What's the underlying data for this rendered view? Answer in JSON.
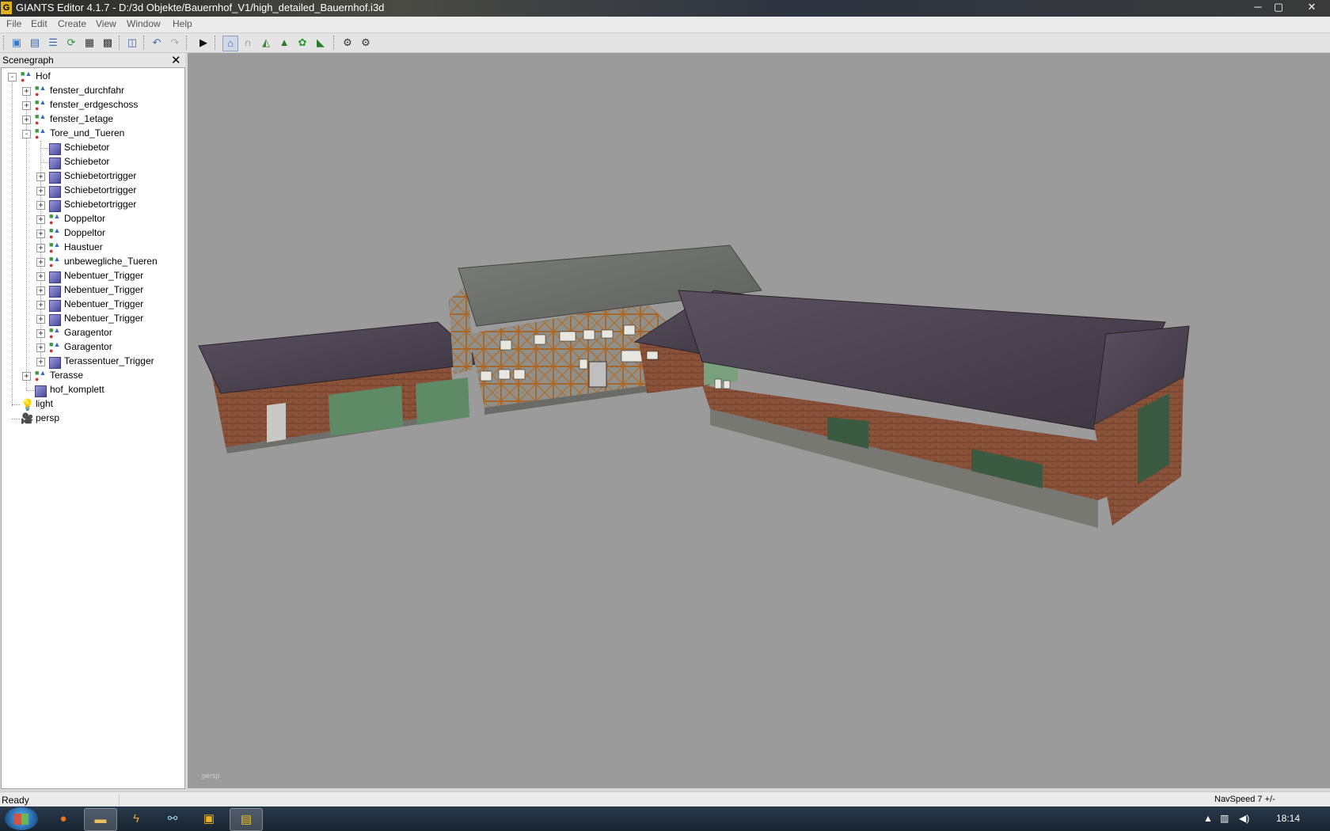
{
  "window": {
    "title": "GIANTS Editor 4.1.7 - D:/3d Objekte/Bauernhof_V1/high_detailed_Bauernhof.i3d",
    "app_icon_letter": "G",
    "minimize": "─",
    "maximize": "▢",
    "close": "✕"
  },
  "menu": {
    "items": [
      "File",
      "Edit",
      "Create",
      "View",
      "Window",
      "Help"
    ]
  },
  "toolbar": {
    "icons": [
      "new-icon",
      "open-icon",
      "list-icon",
      "refresh-icon",
      "save-icon",
      "save-as-icon",
      "scene-icon",
      "undo-icon",
      "redo-icon",
      "play-icon",
      "select-icon",
      "magnet-icon",
      "terrain-raise-icon",
      "terrain-smooth-icon",
      "foliage-icon",
      "terrain-paint-icon",
      "render-settings-icon",
      "render-icon"
    ]
  },
  "scenegraph": {
    "title": "Scenegraph",
    "close": "✕",
    "nodes": [
      {
        "label": "Hof",
        "level": 0,
        "type": "group",
        "expander": "-"
      },
      {
        "label": "fenster_durchfahr",
        "level": 1,
        "type": "group",
        "expander": "+"
      },
      {
        "label": "fenster_erdgeschoss",
        "level": 1,
        "type": "group",
        "expander": "+"
      },
      {
        "label": "fenster_1etage",
        "level": 1,
        "type": "group",
        "expander": "+"
      },
      {
        "label": "Tore_und_Tueren",
        "level": 1,
        "type": "group",
        "expander": "-"
      },
      {
        "label": "Schiebetor",
        "level": 2,
        "type": "shape",
        "expander": ""
      },
      {
        "label": "Schiebetor",
        "level": 2,
        "type": "shape",
        "expander": ""
      },
      {
        "label": "Schiebetortrigger",
        "level": 2,
        "type": "shape",
        "expander": "+"
      },
      {
        "label": "Schiebetortrigger",
        "level": 2,
        "type": "shape",
        "expander": "+"
      },
      {
        "label": "Schiebetortrigger",
        "level": 2,
        "type": "shape",
        "expander": "+"
      },
      {
        "label": "Doppeltor",
        "level": 2,
        "type": "group",
        "expander": "+"
      },
      {
        "label": "Doppeltor",
        "level": 2,
        "type": "group",
        "expander": "+"
      },
      {
        "label": "Haustuer",
        "level": 2,
        "type": "group",
        "expander": "+"
      },
      {
        "label": "unbewegliche_Tueren",
        "level": 2,
        "type": "group",
        "expander": "+"
      },
      {
        "label": "Nebentuer_Trigger",
        "level": 2,
        "type": "shape",
        "expander": "+"
      },
      {
        "label": "Nebentuer_Trigger",
        "level": 2,
        "type": "shape",
        "expander": "+"
      },
      {
        "label": "Nebentuer_Trigger",
        "level": 2,
        "type": "shape",
        "expander": "+"
      },
      {
        "label": "Nebentuer_Trigger",
        "level": 2,
        "type": "shape",
        "expander": "+"
      },
      {
        "label": "Garagentor",
        "level": 2,
        "type": "group",
        "expander": "+"
      },
      {
        "label": "Garagentor",
        "level": 2,
        "type": "group",
        "expander": "+"
      },
      {
        "label": "Terassentuer_Trigger",
        "level": 2,
        "type": "shape",
        "expander": "+"
      },
      {
        "label": "Terasse",
        "level": 1,
        "type": "group",
        "expander": "+"
      },
      {
        "label": "hof_komplett",
        "level": 1,
        "type": "shape",
        "expander": ""
      },
      {
        "label": "light",
        "level": 0,
        "type": "light",
        "expander": ""
      },
      {
        "label": "persp",
        "level": 0,
        "type": "camera",
        "expander": ""
      }
    ]
  },
  "viewport": {
    "camera_label": "persp",
    "background": "#9b9b9b"
  },
  "statusbar": {
    "status": "Ready",
    "navspeed": "NavSpeed 7 +/-"
  },
  "taskbar": {
    "apps": [
      "firefox-icon",
      "explorer-icon",
      "winamp-icon",
      "network-app-icon",
      "outlook-icon",
      "giants-editor-icon"
    ],
    "clock": "18:14"
  }
}
